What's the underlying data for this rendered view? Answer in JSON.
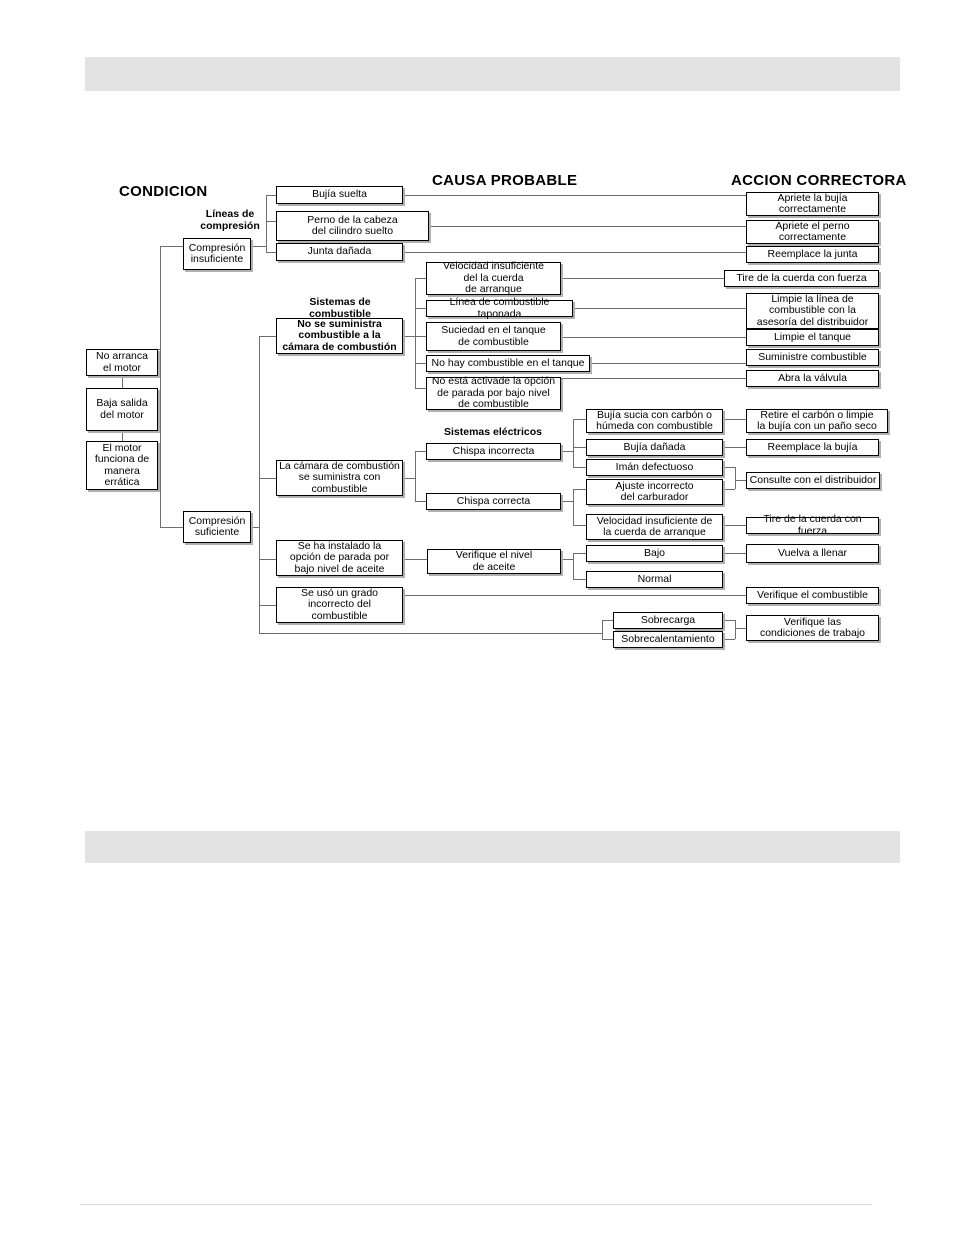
{
  "page": {
    "header_band": "",
    "footer_band": ""
  },
  "headings": {
    "condicion": "CONDICION",
    "causa_probable": "CAUSA PROBABLE",
    "accion_correctora": "ACCION CORRECTORA"
  },
  "group_labels": {
    "lineas_compresion": "Líneas de\ncompresión",
    "sistemas_combustible": "Sistemas de\ncombustible",
    "sistemas_electricos": "Sistemas eléctricos"
  },
  "condition": [
    {
      "id": "no-arranca",
      "label": "No arranca\nel motor"
    },
    {
      "id": "baja-salida",
      "label": "Baja salida\ndel motor"
    },
    {
      "id": "erratica",
      "label": "El motor\nfunciona de\nmanera\nerrática"
    }
  ],
  "compression": [
    {
      "id": "compresion-insuficiente",
      "label": "Compresión\ninsuficiente"
    },
    {
      "id": "compresion-suficiente",
      "label": "Compresión\nsuficiente"
    }
  ],
  "causes": {
    "compression_lines": [
      {
        "id": "bujia-suelta",
        "label": "Bujía suelta"
      },
      {
        "id": "perno-cabeza",
        "label": "Perno de la cabeza\ndel cilindro suelto"
      },
      {
        "id": "junta-danada",
        "label": "Junta dañada"
      }
    ],
    "fuel_branch": {
      "id": "no-suministra",
      "label": "No se suministra\ncombustible a la\ncámara de combustión",
      "bold": true
    },
    "fuel_causes": [
      {
        "id": "velocidad-insuficiente-cuerda",
        "label": "Velocidad insuficiente\ndel la cuerda\nde arranque"
      },
      {
        "id": "linea-taponada",
        "label": "Línea de combustible taponada"
      },
      {
        "id": "suciedad-tanque",
        "label": "Suciedad en el tanque\nde combustible"
      },
      {
        "id": "no-hay-combustible",
        "label": "No hay combustible en el tanque"
      },
      {
        "id": "no-activada-parada",
        "label": "No está activade la opción\nde parada por bajo nivel\nde combustible"
      }
    ],
    "chamber_branch": {
      "id": "camara-suministra",
      "label": "La cámara de combustión\nse suministra con\ncombustible"
    },
    "spark": [
      {
        "id": "chispa-incorrecta",
        "label": "Chispa incorrecta"
      },
      {
        "id": "chispa-correcta",
        "label": "Chispa correcta"
      }
    ],
    "spark_incorrect_causes": [
      {
        "id": "bujia-sucia",
        "label": "Bujía sucia con carbón o\nhúmeda con combustible"
      },
      {
        "id": "bujia-danada",
        "label": "Bujía dañada"
      },
      {
        "id": "iman-defectuoso",
        "label": "Imán defectuoso"
      }
    ],
    "spark_correct_causes": [
      {
        "id": "ajuste-carburador",
        "label": "Ajuste incorrecto\ndel carburador"
      },
      {
        "id": "velocidad-insuficiente-cuerda-2",
        "label": "Velocidad insuficiente de\nla cuerda de arranque"
      }
    ],
    "oil_branch": {
      "id": "opcion-parada-aceite",
      "label": "Se ha instalado la\nopción de parada por\nbajo nivel de aceite"
    },
    "oil_check": {
      "id": "verifique-nivel-aceite",
      "label": "Verifique el nivel\nde aceite"
    },
    "oil_levels": [
      {
        "id": "bajo",
        "label": "Bajo"
      },
      {
        "id": "normal",
        "label": "Normal"
      }
    ],
    "fuel_grade": {
      "id": "grado-incorrecto",
      "label": "Se usó un grado\nincorrecto del\ncombustible"
    },
    "load": [
      {
        "id": "sobrecarga",
        "label": "Sobrecarga"
      },
      {
        "id": "sobrecalentamiento",
        "label": "Sobrecalentamiento"
      }
    ]
  },
  "actions": [
    {
      "id": "apriete-bujia",
      "label": "Apriete la bujía\ncorrectamente"
    },
    {
      "id": "apriete-perno",
      "label": "Apriete el perno\ncorrectamente"
    },
    {
      "id": "reemplace-junta",
      "label": "Reemplace la junta"
    },
    {
      "id": "tire-cuerda-1",
      "label": "Tire de la cuerda con fuerza"
    },
    {
      "id": "limpie-linea",
      "label": "Limpie la línea de\ncombustible con la\nasesoría del distribuidor"
    },
    {
      "id": "limpie-tanque",
      "label": "Limpie el tanque"
    },
    {
      "id": "suministre-combustible",
      "label": "Suministre combustible"
    },
    {
      "id": "abra-valvula",
      "label": "Abra la válvula"
    },
    {
      "id": "retire-carbon",
      "label": "Retire el carbón o limpie\nla bujía con un paño seco"
    },
    {
      "id": "reemplace-bujia",
      "label": "Reemplace la bujía"
    },
    {
      "id": "consulte-distribuidor",
      "label": "Consulte con el distribuidor"
    },
    {
      "id": "tire-cuerda-2",
      "label": "Tire de la cuerda con fuerza"
    },
    {
      "id": "vuelva-llenar",
      "label": "Vuelva a llenar"
    },
    {
      "id": "verifique-combustible",
      "label": "Verifique el combustible"
    },
    {
      "id": "verifique-condiciones",
      "label": "Verifique las\ncondiciones de trabajo"
    }
  ],
  "colors": {
    "band": "#e3e3e3",
    "box_border": "#000000",
    "box_shadow": "#b0b0b0",
    "line": "#6e6e6e",
    "text": "#000000"
  }
}
